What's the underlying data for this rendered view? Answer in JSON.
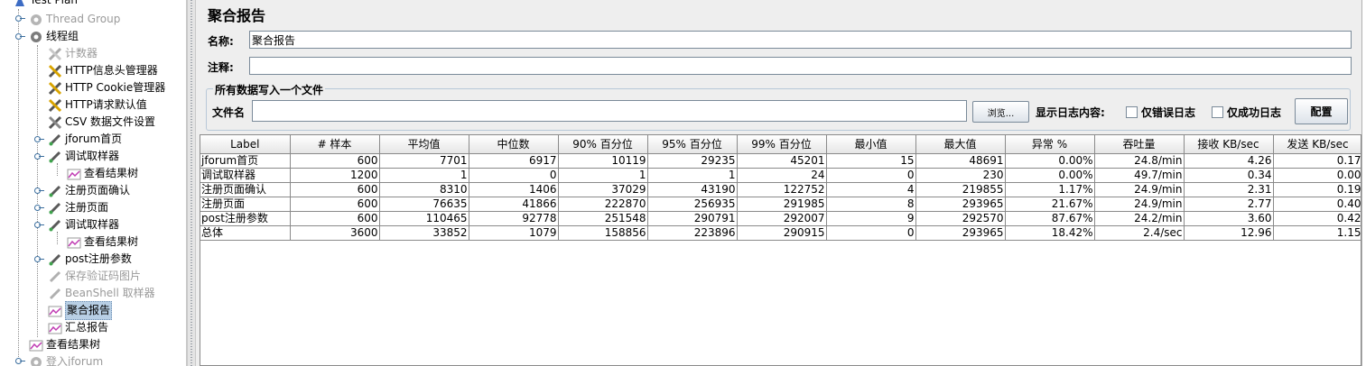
{
  "tree": {
    "items": [
      {
        "label": "Test Plan",
        "icon": "test-plan-icon",
        "disabled": false
      },
      {
        "label": "Thread Group",
        "icon": "gear-icon",
        "disabled": true
      },
      {
        "label": "线程组",
        "icon": "gear-icon",
        "disabled": false
      },
      {
        "label": "计数器",
        "icon": "config-tools-icon",
        "disabled": true
      },
      {
        "label": "HTTP信息头管理器",
        "icon": "config-tools-icon",
        "disabled": false
      },
      {
        "label": "HTTP Cookie管理器",
        "icon": "config-tools-icon",
        "disabled": false
      },
      {
        "label": "HTTP请求默认值",
        "icon": "config-tools-icon",
        "disabled": false
      },
      {
        "label": "CSV 数据文件设置",
        "icon": "config-tools-icon",
        "disabled": false
      },
      {
        "label": "jforum首页",
        "icon": "sampler-pipette-icon",
        "disabled": false
      },
      {
        "label": "调试取样器",
        "icon": "sampler-pipette-icon",
        "disabled": false
      },
      {
        "label": "查看结果树",
        "icon": "listener-graph-icon",
        "disabled": false
      },
      {
        "label": "注册页面确认",
        "icon": "sampler-pipette-icon",
        "disabled": false
      },
      {
        "label": "注册页面",
        "icon": "sampler-pipette-icon",
        "disabled": false
      },
      {
        "label": "调试取样器",
        "icon": "sampler-pipette-icon",
        "disabled": false
      },
      {
        "label": "查看结果树",
        "icon": "listener-graph-icon",
        "disabled": false
      },
      {
        "label": "post注册参数",
        "icon": "sampler-pipette-icon",
        "disabled": false
      },
      {
        "label": "保存验证码图片",
        "icon": "sampler-pipette-icon",
        "disabled": true
      },
      {
        "label": "BeanShell 取样器",
        "icon": "sampler-pipette-icon",
        "disabled": true
      },
      {
        "label": "聚合报告",
        "icon": "listener-graph-icon",
        "disabled": false,
        "selected": true
      },
      {
        "label": "汇总报告",
        "icon": "listener-graph-icon",
        "disabled": false
      },
      {
        "label": "查看结果树",
        "icon": "listener-graph-icon",
        "disabled": false
      },
      {
        "label": "登入jforum",
        "icon": "gear-icon",
        "disabled": true
      }
    ]
  },
  "panel": {
    "title": "聚合报告",
    "name_label": "名称:",
    "name_value": "聚合报告",
    "comment_label": "注释:",
    "comment_value": "",
    "group_title": "所有数据写入一个文件",
    "filename_label": "文件名",
    "filename_value": "",
    "browse_label": "浏览...",
    "log_content_label": "显示日志内容:",
    "errors_only_label": "仅错误日志",
    "success_only_label": "仅成功日志",
    "configure_label": "配置"
  },
  "table": {
    "headers": [
      "Label",
      "# 样本",
      "平均值",
      "中位数",
      "90% 百分位",
      "95% 百分位",
      "99% 百分位",
      "最小值",
      "最大值",
      "异常 %",
      "吞吐量",
      "接收 KB/sec",
      "发送 KB/sec"
    ],
    "rows": [
      [
        "jforum首页",
        "600",
        "7701",
        "6917",
        "10119",
        "29235",
        "45201",
        "15",
        "48691",
        "0.00%",
        "24.8/min",
        "4.26",
        "0.17"
      ],
      [
        "调试取样器",
        "1200",
        "1",
        "0",
        "1",
        "1",
        "24",
        "0",
        "230",
        "0.00%",
        "49.7/min",
        "0.34",
        "0.00"
      ],
      [
        "注册页面确认",
        "600",
        "8310",
        "1406",
        "37029",
        "43190",
        "122752",
        "4",
        "219855",
        "1.17%",
        "24.9/min",
        "2.31",
        "0.19"
      ],
      [
        "注册页面",
        "600",
        "76635",
        "41866",
        "222870",
        "256935",
        "291985",
        "8",
        "293965",
        "21.67%",
        "24.9/min",
        "2.77",
        "0.40"
      ],
      [
        "post注册参数",
        "600",
        "110465",
        "92778",
        "251548",
        "290791",
        "292007",
        "9",
        "292570",
        "87.67%",
        "24.2/min",
        "3.60",
        "0.42"
      ],
      [
        "总体",
        "3600",
        "33852",
        "1079",
        "158856",
        "223896",
        "290915",
        "0",
        "293965",
        "18.42%",
        "2.4/sec",
        "12.96",
        "1.15"
      ]
    ]
  }
}
